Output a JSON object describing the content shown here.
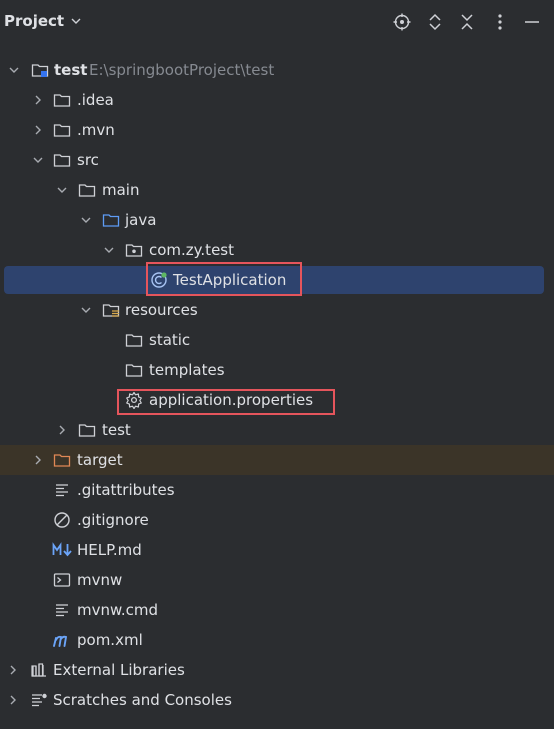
{
  "header": {
    "title": "Project",
    "icons": [
      "locate-icon",
      "expand-all-icon",
      "collapse-all-icon",
      "options-icon",
      "minimize-icon"
    ]
  },
  "tree": [
    {
      "label": "test",
      "path": "E:\\springbootProject\\test",
      "icon": "module-folder-icon",
      "expanded": true
    },
    {
      "label": ".idea",
      "icon": "folder-icon",
      "expanded": false
    },
    {
      "label": ".mvn",
      "icon": "folder-icon",
      "expanded": false
    },
    {
      "label": "src",
      "icon": "folder-icon",
      "expanded": true
    },
    {
      "label": "main",
      "icon": "folder-icon",
      "expanded": true
    },
    {
      "label": "java",
      "icon": "source-folder-icon",
      "expanded": true
    },
    {
      "label": "com.zy.test",
      "icon": "package-icon",
      "expanded": true
    },
    {
      "label": "TestApplication",
      "icon": "spring-boot-class-icon",
      "selected": true,
      "highlighted": true
    },
    {
      "label": "resources",
      "icon": "resources-folder-icon",
      "expanded": true
    },
    {
      "label": "static",
      "icon": "folder-icon"
    },
    {
      "label": "templates",
      "icon": "folder-icon"
    },
    {
      "label": "application.properties",
      "icon": "settings-gear-icon",
      "highlighted": true
    },
    {
      "label": "test",
      "icon": "folder-icon",
      "expanded": false
    },
    {
      "label": "target",
      "icon": "excluded-folder-icon",
      "expanded": false
    },
    {
      "label": ".gitattributes",
      "icon": "text-file-icon"
    },
    {
      "label": ".gitignore",
      "icon": "ignore-file-icon"
    },
    {
      "label": "HELP.md",
      "icon": "markdown-icon"
    },
    {
      "label": "mvnw",
      "icon": "shell-script-icon"
    },
    {
      "label": "mvnw.cmd",
      "icon": "text-file-icon"
    },
    {
      "label": "pom.xml",
      "icon": "maven-icon"
    },
    {
      "label": "External Libraries",
      "icon": "libraries-icon",
      "expanded": false
    },
    {
      "label": "Scratches and Consoles",
      "icon": "scratches-icon",
      "expanded": false
    }
  ],
  "colors": {
    "background": "#2b2d30",
    "selection": "#2e436e",
    "excluded_band": "#3b3428",
    "highlight_box": "#e5555c",
    "path_text": "#868a91"
  }
}
